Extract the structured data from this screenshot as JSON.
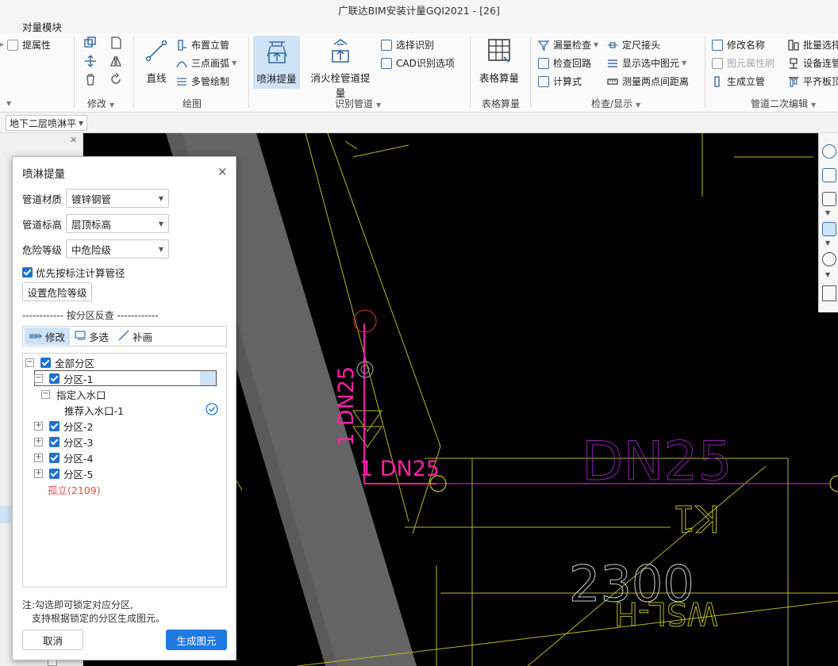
{
  "window": {
    "title": "广联达BIM安装计量GQI2021 - [26]"
  },
  "menu": {
    "items": [
      "对量模块"
    ]
  },
  "ribbon": {
    "left_edge": {
      "attr_label": "提属性"
    },
    "modify_group": {
      "label": "修改"
    },
    "draw_group": {
      "label": "绘图",
      "line_label": "直线",
      "riser_label": "布置立管",
      "arc_label": "三点画弧",
      "multipipe_label": "多管绘制"
    },
    "recognize_group": {
      "label": "识别管道",
      "sprinkler_label": "喷淋提量",
      "hydrant_label": "消火栓管道提量",
      "select_recognize_label": "选择识别",
      "cad_options_label": "CAD识别选项"
    },
    "table_group": {
      "label": "表格算量",
      "button_label": "表格算量"
    },
    "check_group": {
      "label": "检查/显示",
      "leak_check_label": "漏量检查",
      "fixed_joint_label": "定尺接头",
      "check_loop_label": "检查回路",
      "show_selected_label": "显示选中图元",
      "formula_label": "计算式",
      "measure_label": "测量两点间距离"
    },
    "pipe_edit_group": {
      "label": "管道二次编辑",
      "rename_label": "修改名称",
      "batch_select_label": "批量选择",
      "attr_brush_label": "图元属性刷",
      "equipment_label": "设备连管",
      "gen_riser_label": "生成立管",
      "align_label": "平齐板顶"
    }
  },
  "layer_select": {
    "value": "地下二层喷淋平"
  },
  "dialog": {
    "title": "喷淋提量",
    "fields": [
      {
        "label": "管道材质",
        "value": "镀锌钢管"
      },
      {
        "label": "管道标高",
        "value": "层顶标高"
      },
      {
        "label": "危险等级",
        "value": "中危险级"
      }
    ],
    "priority_checkbox_label": "优先按标注计算管径",
    "set_hazard_button": "设置危险等级",
    "section_label": "------------  按分区反查  ------------",
    "tools": {
      "modify": "修改",
      "multiselect": "多选",
      "supplement": "补画"
    },
    "tree": {
      "root": "全部分区",
      "zone1": "分区-1",
      "inlet_parent": "指定入水口",
      "inlet_child": "推荐入水口-1",
      "zones": [
        "分区-2",
        "分区-3",
        "分区-4",
        "分区-5"
      ],
      "isolated": "孤立(2109)"
    },
    "note_line1": "注:勾选即可锁定对应分区,",
    "note_line2": "支持根据锁定的分区生成图元。",
    "cancel_button": "取消",
    "generate_button": "生成图元"
  },
  "cad": {
    "label_vertical": "1 DN25",
    "label_horizontal": "1 DN25",
    "label_large": "DN25",
    "label_number": "2300",
    "label_mirror1": "K1",
    "label_mirror2": "WSL-H"
  },
  "colors": {
    "accent": "#1f7ae0",
    "magenta": "#ff1fa8",
    "cad_yellow": "#b8b820",
    "isolated_red": "#d9534f"
  }
}
